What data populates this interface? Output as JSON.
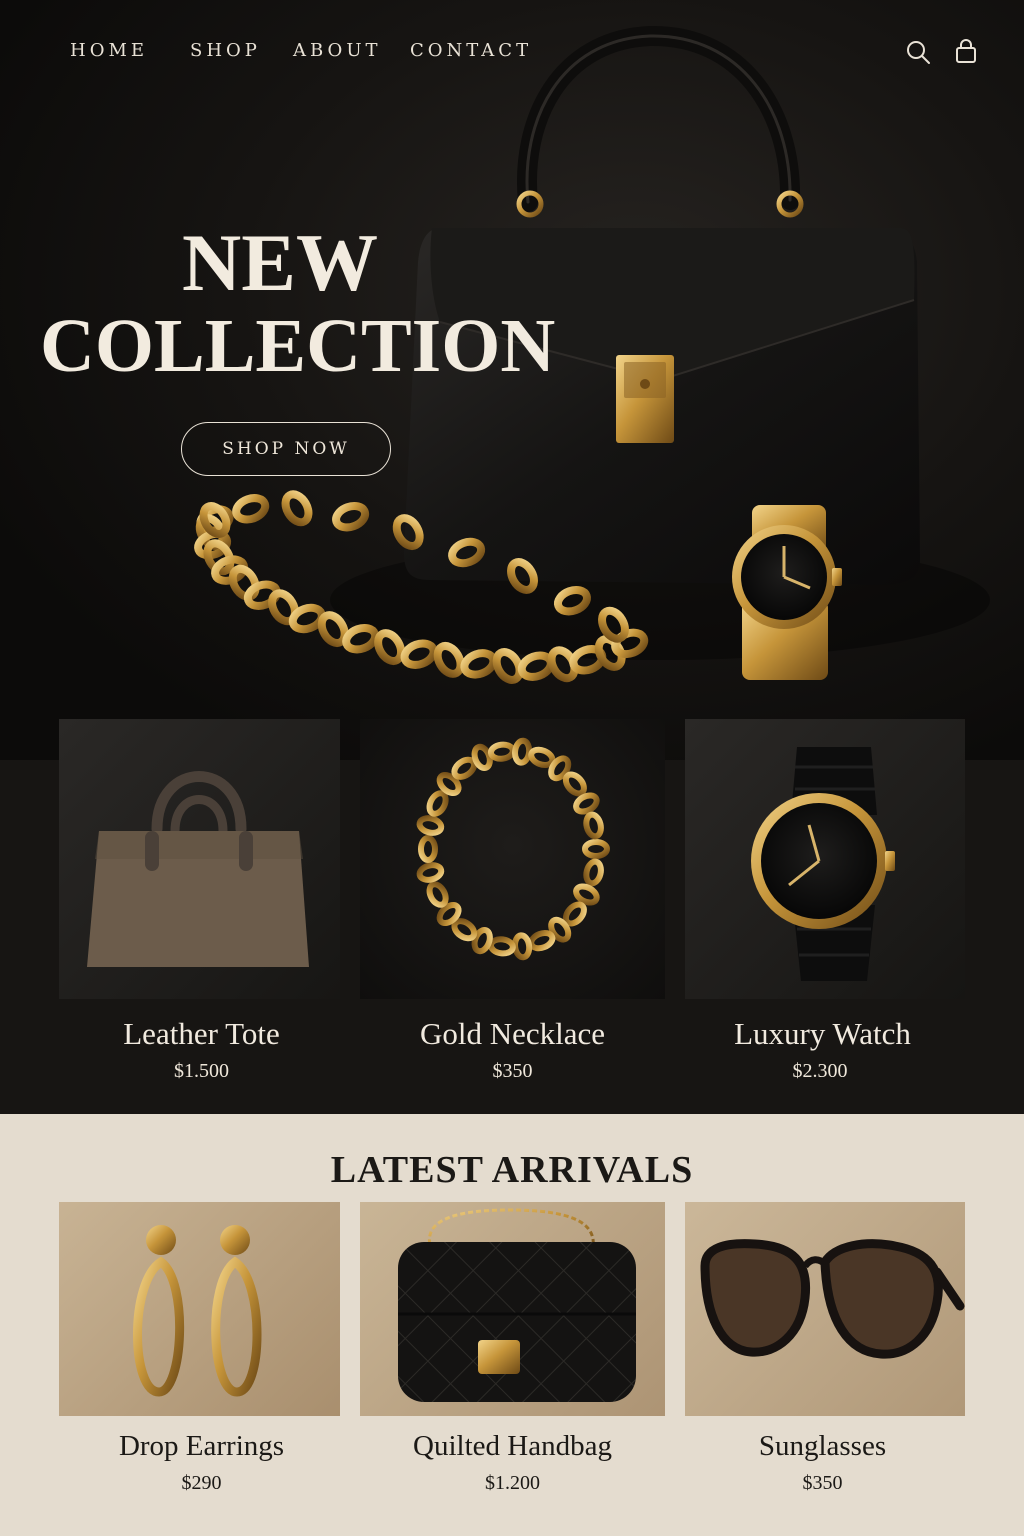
{
  "nav": {
    "links": [
      "HOME",
      "SHOP",
      "ABOUT",
      "CONTACT"
    ],
    "icons": [
      "search-icon",
      "bag-icon"
    ]
  },
  "hero": {
    "title_line1": "NEW",
    "title_line2": "COLLECTION",
    "cta_label": "SHOP NOW"
  },
  "featured": [
    {
      "name": "Leather Tote",
      "price": "$1.500",
      "image": "leather-tote"
    },
    {
      "name": "Gold Necklace",
      "price": "$350",
      "image": "gold-necklace"
    },
    {
      "name": "Luxury Watch",
      "price": "$2.300",
      "image": "luxury-watch"
    }
  ],
  "latest": {
    "title": "LATEST ARRIVALS",
    "items": [
      {
        "name": "Drop Earrings",
        "price": "$290",
        "image": "drop-earrings"
      },
      {
        "name": "Quilted Handbag",
        "price": "$1.200",
        "image": "quilted-handbag"
      },
      {
        "name": "Sunglasses",
        "price": "$350",
        "image": "sunglasses"
      }
    ]
  },
  "colors": {
    "background": "#0d0c0b",
    "gold": "#c89a3c",
    "cream": "#e4dccf",
    "text_light": "#efe7da",
    "text_dark": "#1b1916"
  }
}
